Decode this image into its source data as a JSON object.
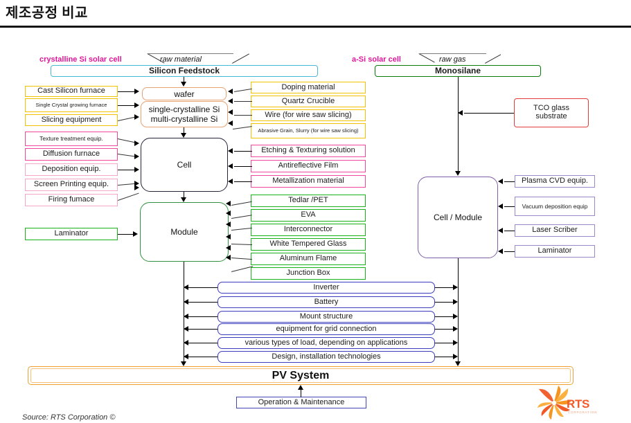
{
  "header": {
    "title": "제조공정 비교"
  },
  "left_branch": {
    "branch_label": "crystalline Si solar cell",
    "funnel_label": "raw material",
    "feedstock": "Silicon Feedstock",
    "wafer_top": "wafer",
    "wafer_bottom_line1": "single-crystalline Si",
    "wafer_bottom_line2": "multi-crystalline Si",
    "cell": "Cell",
    "module": "Module"
  },
  "right_branch": {
    "branch_label": "a-Si solar cell",
    "funnel_label": "raw gas",
    "feedstock": "Monosilane",
    "cell_module": "Cell / Module",
    "tco": "TCO glass\nsubstrate",
    "tco_line1": "TCO glass",
    "tco_line2": "substrate"
  },
  "wafer_equipment": [
    {
      "label": "Cast Silicon furnace",
      "color": "#f2c200"
    },
    {
      "label": "Single Crystal growing furnace",
      "color": "#f2c200"
    },
    {
      "label": "Slicing equipment",
      "color": "#f2c200"
    }
  ],
  "cell_equipment": [
    {
      "label": "Texture treatment equip.",
      "color": "#f0469b"
    },
    {
      "label": "Diffusion furnace",
      "color": "#f0469b"
    },
    {
      "label": "Deposition equip.",
      "color": "#f3a6c8"
    },
    {
      "label": "Screen Printing equip.",
      "color": "#f3a6c8"
    },
    {
      "label": "Firing fumace",
      "color": "#f3a6c8"
    }
  ],
  "module_equipment": [
    {
      "label": "Laminator",
      "color": "#19b219"
    }
  ],
  "wafer_materials": [
    {
      "label": "Doping material",
      "color": "#f2c200"
    },
    {
      "label": "Quartz Crucible",
      "color": "#f2c200"
    },
    {
      "label": "Wire (for wire saw slicing)",
      "color": "#f2c200"
    },
    {
      "label": "Abrasive Grain, Slurry (for wire saw slicing)",
      "color": "#f2c200"
    }
  ],
  "cell_materials": [
    {
      "label": "Etching & Texturing solution",
      "color": "#d4579c"
    },
    {
      "label": "Antireflective Film",
      "color": "#f0469b"
    },
    {
      "label": "Metallization material",
      "color": "#c74f8f"
    }
  ],
  "module_materials": [
    {
      "label": "Tedlar /PET",
      "color": "#19b219"
    },
    {
      "label": "EVA",
      "color": "#19b219"
    },
    {
      "label": "Interconnector",
      "color": "#19b219"
    },
    {
      "label": "White Tempered Glass",
      "color": "#19b219"
    },
    {
      "label": "Aluminum Flame",
      "color": "#19b219"
    },
    {
      "label": "Junction Box",
      "color": "#19b219"
    }
  ],
  "asi_equipment": [
    {
      "label": "Plasma CVD equip.",
      "color": "#9a87c9"
    },
    {
      "label": "Vacuum deposition equip",
      "color": "#9a87c9"
    },
    {
      "label": "Laser Scriber",
      "color": "#9a87c9"
    },
    {
      "label": "Laminator",
      "color": "#9a87c9"
    }
  ],
  "system_components": [
    {
      "label": "Inverter"
    },
    {
      "label": "Battery"
    },
    {
      "label": "Mount structure"
    },
    {
      "label": "equipment for grid connection"
    },
    {
      "label": "various types of load, depending on applications"
    },
    {
      "label": "Design, installation technologies"
    }
  ],
  "footer": {
    "pv_system": "PV System",
    "operation": "Operation & Maintenance",
    "source": "Source: RTS Corporation ©",
    "logo_text": "RTS",
    "logo_sub": "CORPORATION"
  },
  "colors": {
    "yellow": "#f2c200",
    "pink": "#f0469b",
    "green": "#19b219",
    "blue": "#3b3bbf",
    "purple": "#9a87c9",
    "orange": "#f0a030",
    "magenta": "#e0189b",
    "cyan": "#49b9d6",
    "red": "#e03c3c"
  }
}
